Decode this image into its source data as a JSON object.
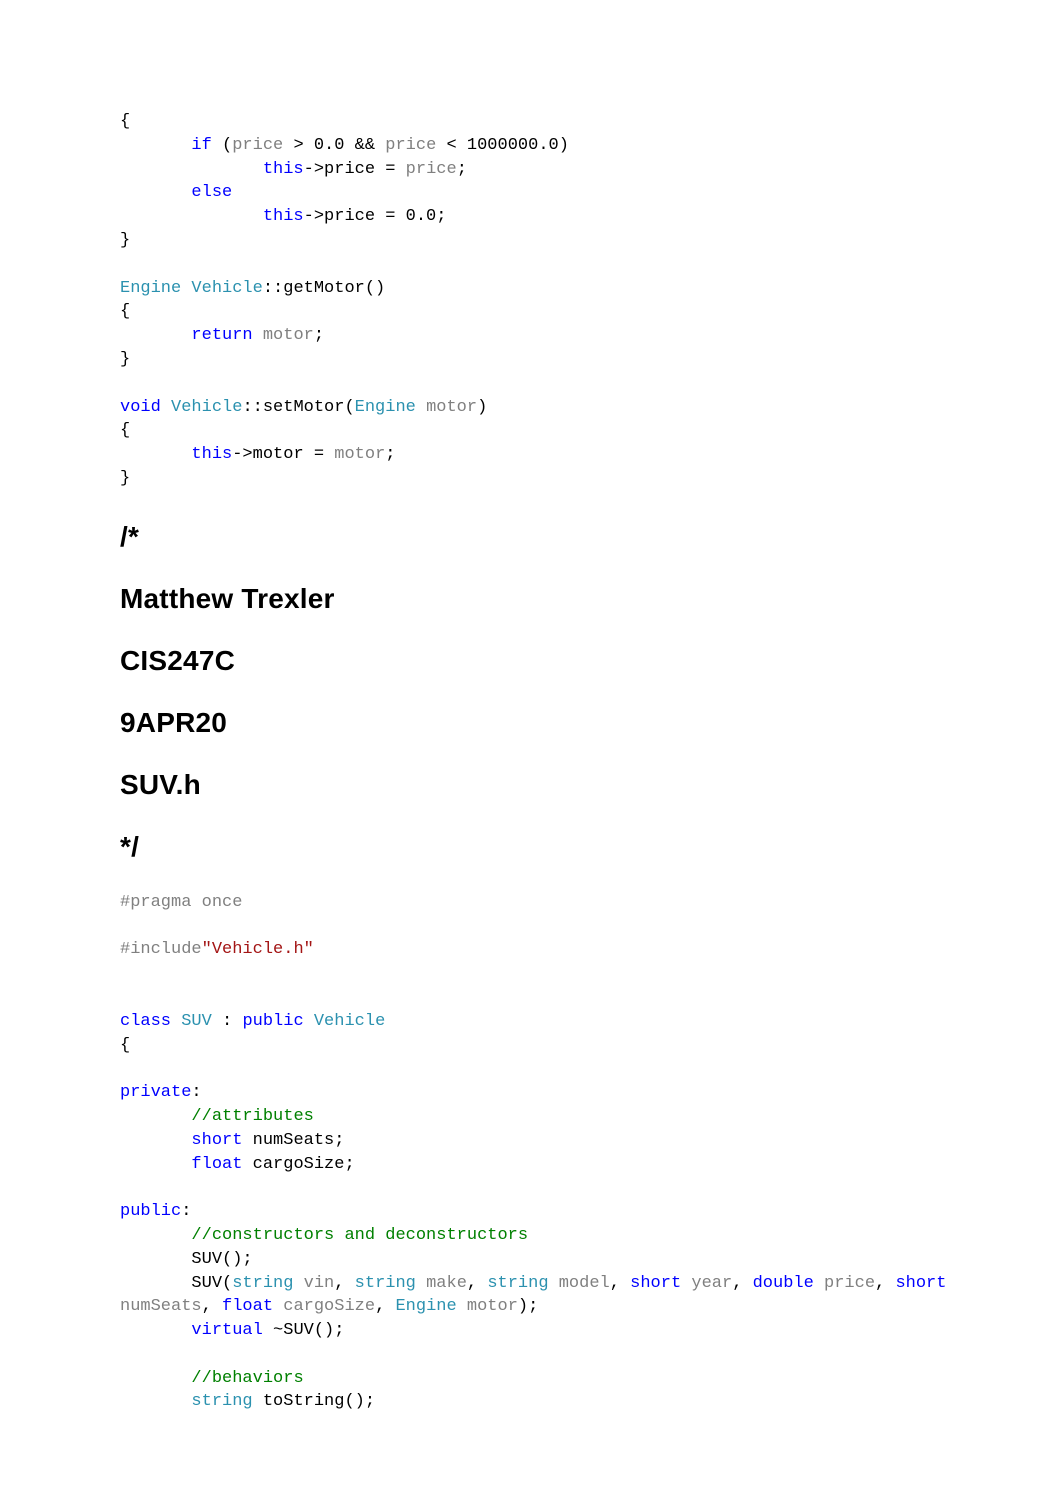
{
  "code1": {
    "l1_o": "{",
    "l2_if": "if",
    "l2_p1": "price",
    "l2_gt0": " > 0.0 && ",
    "l2_p2": "price",
    "l2_gt1": " < 1000000.0)",
    "l3_this": "this",
    "l3_arrow": "->price = ",
    "l3_price": "price",
    "l3_semi": ";",
    "l4_else": "else",
    "l5_this": "this",
    "l5_rest": "->price = 0.0;",
    "l6_c": "}",
    "l8_engine": "Engine",
    "l8_veh": "Vehicle",
    "l8_rest": "::getMotor()",
    "l9_o": "{",
    "l10_ret": "return",
    "l10_motor": "motor",
    "l10_semi": ";",
    "l11_c": "}",
    "l13_void": "void",
    "l13_veh": "Vehicle",
    "l13_setm": "::setMotor(",
    "l13_eng": "Engine",
    "l13_par": "motor",
    "l13_close": ")",
    "l14_o": "{",
    "l15_this": "this",
    "l15_arrow": "->motor = ",
    "l15_motor": "motor",
    "l15_semi": ";",
    "l16_c": "}"
  },
  "headings": {
    "h1": "/*",
    "h2": "Matthew Trexler",
    "h3": "CIS247C",
    "h4": "9APR20",
    "h5": "SUV.h",
    "h6": "*/"
  },
  "code2": {
    "pragma": "#pragma once",
    "include": "#include",
    "include_str": "\"Vehicle.h\"",
    "class": "class",
    "suv": "SUV",
    "colon": " : ",
    "public": "public",
    "vehicle": "Vehicle",
    "open": "{",
    "private": "private",
    "priv_colon": ":",
    "cm_attr": "//attributes",
    "short1": "short",
    "numSeats_decl": " numSeats;",
    "float1": "float",
    "cargo_decl": " cargoSize;",
    "public2": "public",
    "pub_colon": ":",
    "cm_ctor": "//constructors and deconstructors",
    "suv_ctor0": "SUV();",
    "suv_open": "SUV(",
    "str_t": "string",
    "vin": "vin",
    "make": "make",
    "model": "model",
    "short_t": "short",
    "year": "year",
    "double_t": "double",
    "price": "price",
    "numSeats_p": "numSeats",
    "float_t": "float",
    "cargo_p": "cargoSize",
    "eng_t": "Engine",
    "motor_p": "motor",
    "close_paren": ");",
    "virtual": "virtual",
    "dtor": " ~SUV();",
    "cm_beh": "//behaviors",
    "tostr_ret": "string",
    "tostr": " toString();",
    "comma": ", "
  }
}
